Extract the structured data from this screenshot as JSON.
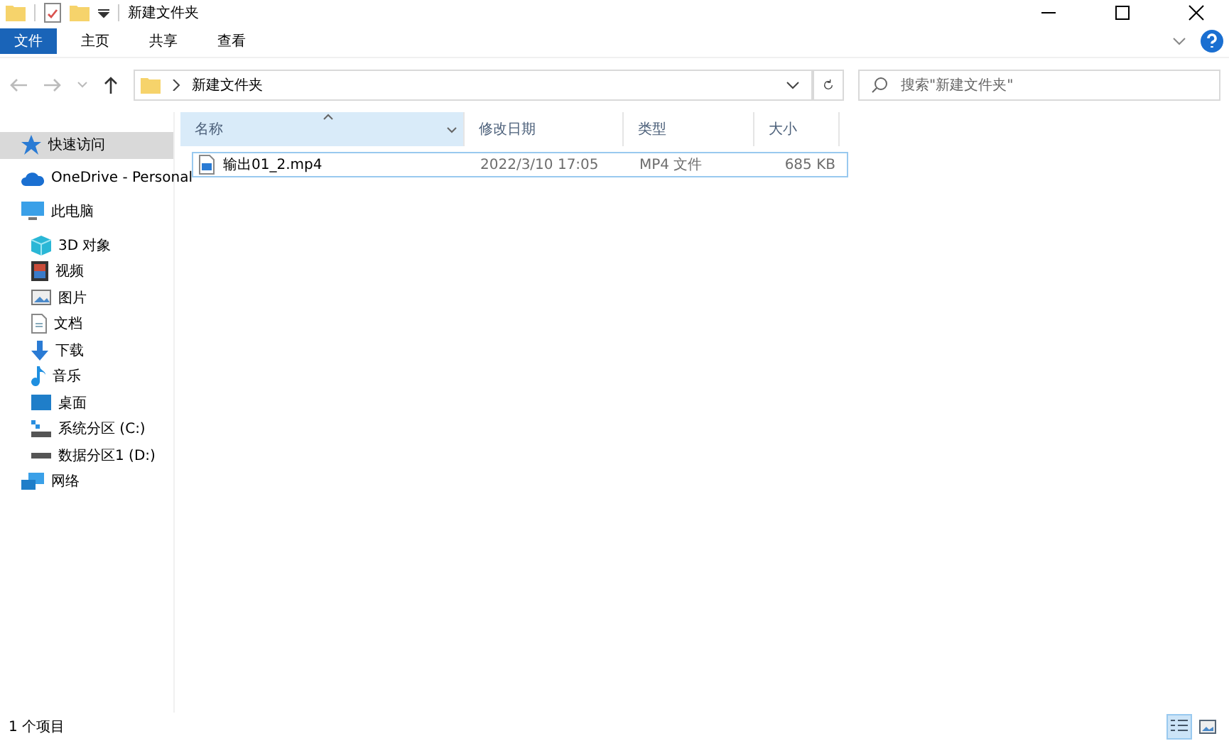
{
  "window": {
    "title": "新建文件夹"
  },
  "ribbon": {
    "tabs": [
      {
        "label": "文件",
        "kind": "file"
      },
      {
        "label": "主页",
        "kind": "tab"
      },
      {
        "label": "共享",
        "kind": "tab"
      },
      {
        "label": "查看",
        "kind": "tab"
      }
    ]
  },
  "address_bar": {
    "path": [
      "新建文件夹"
    ]
  },
  "search": {
    "placeholder": "搜索\"新建文件夹\""
  },
  "sidebar": {
    "items": [
      {
        "label": "快速访问",
        "kind": "star",
        "selected": true
      },
      {
        "label": "OneDrive - Personal",
        "kind": "cloud",
        "selected": false
      },
      {
        "label": "此电脑",
        "kind": "pc",
        "selected": false,
        "children": [
          {
            "label": "3D 对象",
            "kind": "cube",
            "selected": false
          },
          {
            "label": "视频",
            "kind": "video",
            "selected": false
          },
          {
            "label": "图片",
            "kind": "picture",
            "selected": false
          },
          {
            "label": "文档",
            "kind": "document",
            "selected": false
          },
          {
            "label": "下载",
            "kind": "download",
            "selected": false
          },
          {
            "label": "音乐",
            "kind": "music",
            "selected": false
          },
          {
            "label": "桌面",
            "kind": "desktop",
            "selected": false
          },
          {
            "label": "系统分区 (C:)",
            "kind": "sysdrive",
            "selected": false
          },
          {
            "label": "数据分区1 (D:)",
            "kind": "drive",
            "selected": false
          }
        ]
      },
      {
        "label": "网络",
        "kind": "network",
        "selected": false
      }
    ]
  },
  "table": {
    "columns": [
      {
        "label": "名称",
        "sorted": true
      },
      {
        "label": "修改日期",
        "sorted": false
      },
      {
        "label": "类型",
        "sorted": false
      },
      {
        "label": "大小",
        "sorted": false
      }
    ],
    "rows": [
      {
        "cells": [
          "输出01_2.mp4",
          "2022/3/10 17:05",
          "MP4 文件",
          "685 KB"
        ],
        "focused": true
      }
    ]
  },
  "status_bar": {
    "count": "1 个项目",
    "views": [
      {
        "kind": "details",
        "selected": true
      },
      {
        "kind": "thumbs",
        "selected": false
      }
    ]
  }
}
